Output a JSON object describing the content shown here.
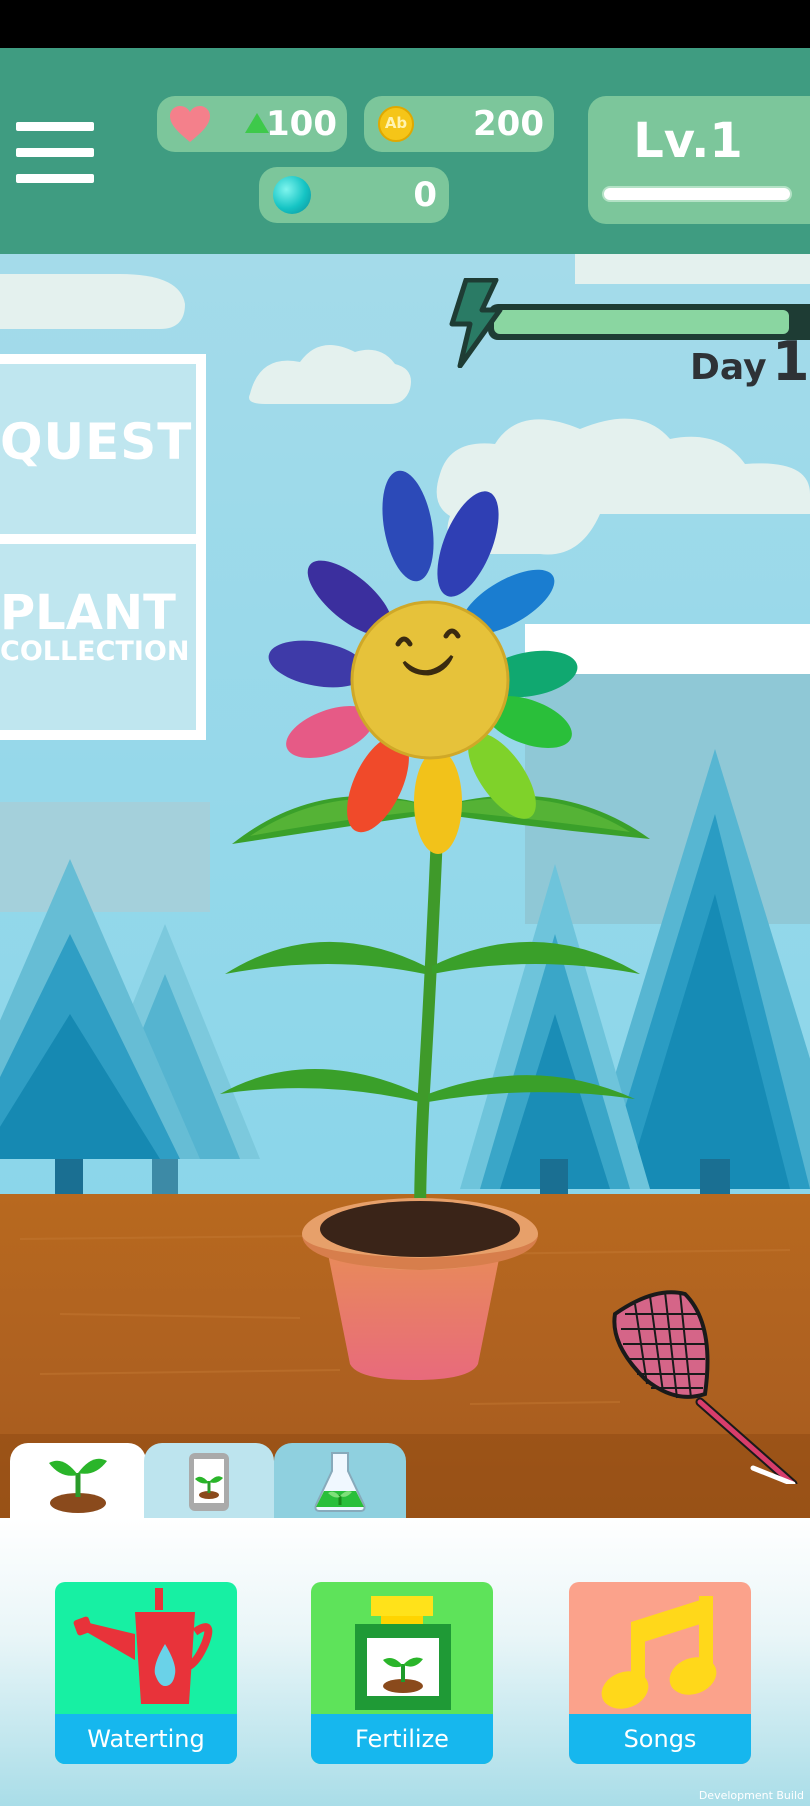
{
  "hud": {
    "health": "100",
    "coins": "200",
    "gems": "0",
    "coin_symbol": "Ab",
    "level": "Lv.1",
    "level_progress": 0,
    "energy": 0.95
  },
  "scene": {
    "day_label": "Day",
    "day_number": "1",
    "quest_label": "QUEST",
    "plant_label": "PLANT",
    "collection_label": "COLLECTION"
  },
  "tabs": [
    {
      "icon": "sprout-icon",
      "active": true
    },
    {
      "icon": "phone-plant-icon",
      "active": false
    },
    {
      "icon": "flask-icon",
      "active": false
    }
  ],
  "actions": {
    "watering_label": "Waterting",
    "fertilize_label": "Fertilize",
    "songs_label": "Songs"
  },
  "footer": {
    "build_label": "Development Build"
  },
  "colors": {
    "topbar": "#3f9c81",
    "pill": "#7cc69b",
    "sky": "#9ddbe9",
    "table": "#b2651f",
    "watering_bg": "#17f0a3",
    "fertilize_bg": "#5ee35a",
    "songs_bg": "#fba28b",
    "action_label_bg": "#16b7ee"
  }
}
